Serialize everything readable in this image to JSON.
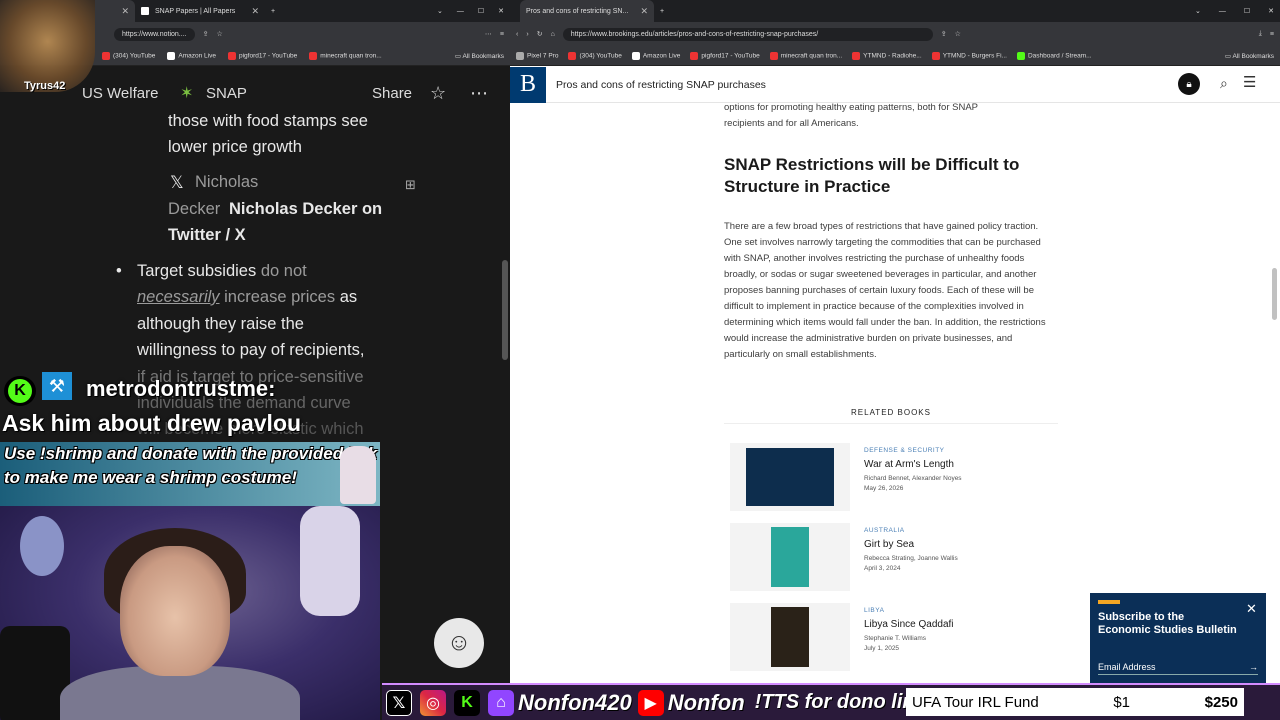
{
  "left_browser": {
    "tabs": [
      {
        "label": ""
      },
      {
        "label": "SNAP Papers | All Papers"
      }
    ],
    "url": "https://www.notion....",
    "bookmarks": [
      "(304) YouTube",
      "Amazon Live",
      "pigford17 - YouTube",
      "minecraft quan tron..."
    ],
    "all_bookmarks": "All Bookmarks"
  },
  "notion": {
    "breadcrumb": [
      "US Welfare",
      "SNAP"
    ],
    "share": "Share",
    "lines": {
      "l1": "those with food stamps see",
      "l2": "lower price growth",
      "link_x": "Nicholas",
      "link_decker": "Decker",
      "link_title": "Nicholas Decker on",
      "link_title2": "Twitter / X",
      "bullet_a": "Target subsidies",
      "bullet_b": "do not",
      "bullet_c": "necessarily",
      "bullet_d": "increase prices",
      "bullet_e": "as",
      "bullet_l2": "although they raise the",
      "bullet_l3": "willingness to pay of recipients,",
      "bullet_l4": "if aid is target to price-sensitive",
      "bullet_l5": "individuals the demand curve",
      "bullet_l6": "will become more elastic which"
    }
  },
  "stream": {
    "streamer_tag": "Tyrus42",
    "chat_user": "metrodontrustme:",
    "chat_msg": "Ask him about drew pavlou",
    "banner_l1": "Use !shrimp and donate with the provided link",
    "banner_l2": "to make me wear a shrimp costume!"
  },
  "right_browser": {
    "tabs": [
      {
        "label": "Pros and cons of restricting SN..."
      }
    ],
    "url": "https://www.brookings.edu/articles/pros-and-cons-of-restricting-snap-purchases/",
    "bookmarks": [
      "Pixel 7 Pro",
      "(304) YouTube",
      "Amazon Live",
      "pigford17 - YouTube",
      "minecraft quan tron...",
      "YTMND - Radiohe...",
      "YTMND - Burgers Fi...",
      "Dashboard / Stream..."
    ],
    "all_bookmarks": "All Bookmarks"
  },
  "article": {
    "site_title": "Pros and cons of restricting SNAP purchases",
    "logo": "B",
    "intro_l1": "options for promoting healthy eating patterns, both for SNAP",
    "intro_l2": "recipients and for all Americans.",
    "heading": "SNAP Restrictions will be Difficult to Structure in Practice",
    "para": "There are a few broad types of restrictions that have gained policy traction. One set involves narrowly targeting the commodities that can be purchased with SNAP, another involves restricting the purchase of unhealthy foods broadly, or sodas or sugar sweetened beverages in particular, and another proposes banning purchases of certain luxury foods. Each of these will be difficult to implement in practice because of the complexities involved in determining which items would fall under the ban. In addition, the restrictions would increase the administrative burden on private businesses, and particularly on small establishments.",
    "related_label": "RELATED BOOKS",
    "books": [
      {
        "category": "DEFENSE & SECURITY",
        "title": "War at Arm's Length",
        "authors": "Richard Bennet, Alexander Noyes",
        "date": "May 26, 2026"
      },
      {
        "category": "AUSTRALIA",
        "title": "Girt by Sea",
        "authors": "Rebecca Strating, Joanne Wallis",
        "date": "April 3, 2024"
      },
      {
        "category": "LIBYA",
        "title": "Libya Since Qaddafi",
        "authors": "Stephanie T. Williams",
        "date": "July 1, 2025"
      }
    ],
    "subscribe_title": "Subscribe to the Economic Studies Bulletin",
    "email_placeholder": "Email Address"
  },
  "ticker": {
    "handle1": "Nonfon420",
    "handle2": "Nonfon",
    "tts": "!TTS for dono link",
    "fund_name": "UFA Tour IRL Fund",
    "fund_current": "$1",
    "fund_goal": "$250"
  },
  "colors": {
    "brookings_blue": "#003a70",
    "ticker_bg": "#2a1a3a",
    "banner": "#1b5e7a"
  }
}
